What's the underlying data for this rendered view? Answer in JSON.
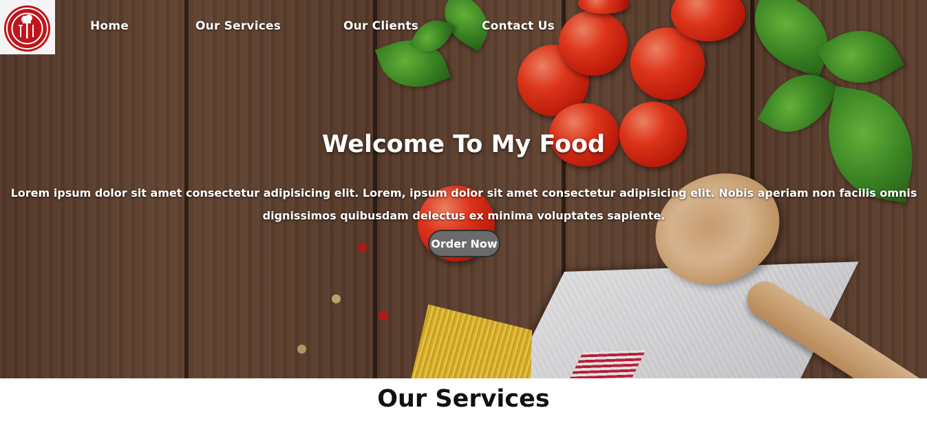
{
  "nav": {
    "logo_icon": "restaurant-logo",
    "items": [
      {
        "label": "Home"
      },
      {
        "label": "Our Services"
      },
      {
        "label": "Our Clients"
      },
      {
        "label": "Contact Us"
      }
    ]
  },
  "hero": {
    "title": "Welcome To My Food",
    "text": "Lorem ipsum dolor sit amet consectetur adipisicing elit. Lorem, ipsum dolor sit amet consectetur adipisicing elit. Nobis aperiam non facilis omnis dignissimos quibusdam delectus ex minima voluptates sapiente.",
    "button_label": "Order Now"
  },
  "services": {
    "title": "Our Services"
  },
  "colors": {
    "logo_red": "#c0151b",
    "button_gray": "#6b6b6b",
    "wood_brown": "#5a3d2d"
  }
}
